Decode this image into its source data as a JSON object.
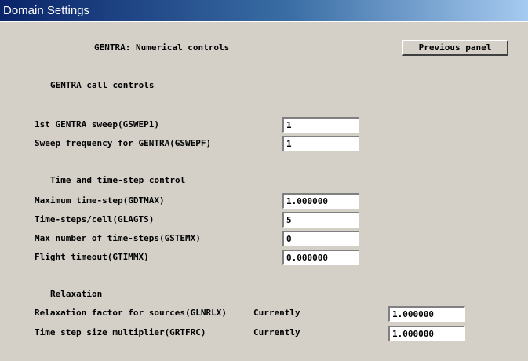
{
  "window": {
    "title": "Domain Settings"
  },
  "header": {
    "panel_title": "GENTRA: Numerical controls",
    "previous_button": "Previous panel"
  },
  "sections": {
    "call_controls": "GENTRA call controls",
    "time_step": "Time and time-step control",
    "relaxation": "Relaxation"
  },
  "call_controls": {
    "gswep1": {
      "label": "1st GENTRA sweep(GSWEP1)",
      "value": "1"
    },
    "gswepf": {
      "label": "Sweep frequency for GENTRA(GSWEPF)",
      "value": "1"
    }
  },
  "time_step": {
    "gdtmax": {
      "label": "Maximum time-step(GDTMAX)",
      "value": "1.000000"
    },
    "glagts": {
      "label": "Time-steps/cell(GLAGTS)",
      "value": "5"
    },
    "gstemx": {
      "label": "Max number of time-steps(GSTEMX)",
      "value": "0"
    },
    "gtimmx": {
      "label": "Flight timeout(GTIMMX)",
      "value": "0.000000"
    }
  },
  "relaxation": {
    "glnrlx": {
      "label": "Relaxation factor for sources(GLNRLX)",
      "note": "Currently",
      "value": "1.000000"
    },
    "grtfrc": {
      "label": "Time step size multiplier(GRTFRC)",
      "note": "Currently",
      "value": "1.000000"
    }
  }
}
